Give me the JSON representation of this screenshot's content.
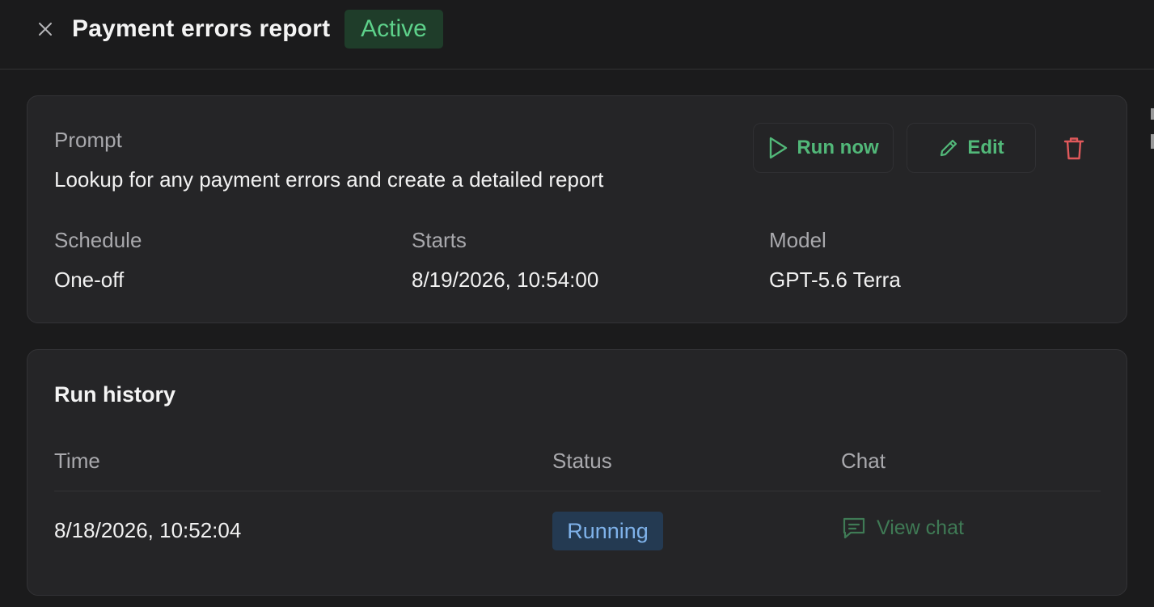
{
  "header": {
    "title": "Payment errors report",
    "status": "Active",
    "close_icon": "close-icon"
  },
  "prompt_card": {
    "prompt_label": "Prompt",
    "prompt_text": "Lookup for any payment errors and create a detailed report",
    "actions": {
      "run_now": "Run now",
      "edit": "Edit",
      "delete_icon": "trash-icon"
    },
    "details": [
      {
        "label": "Schedule",
        "value": "One-off"
      },
      {
        "label": "Starts",
        "value": "8/19/2026, 10:54:00"
      },
      {
        "label": "Model",
        "value": "GPT-5.6 Terra"
      }
    ]
  },
  "run_history": {
    "title": "Run history",
    "columns": [
      "Time",
      "Status",
      "Chat"
    ],
    "rows": [
      {
        "time": "8/18/2026, 10:52:04",
        "status": "Running",
        "chat": "View chat"
      }
    ]
  },
  "colors": {
    "background": "#1b1b1c",
    "card": "#252527",
    "accent_green": "#52b879",
    "active_badge_bg": "#1f3d2a",
    "running_badge_bg": "#243a52",
    "danger": "#e0595b"
  }
}
